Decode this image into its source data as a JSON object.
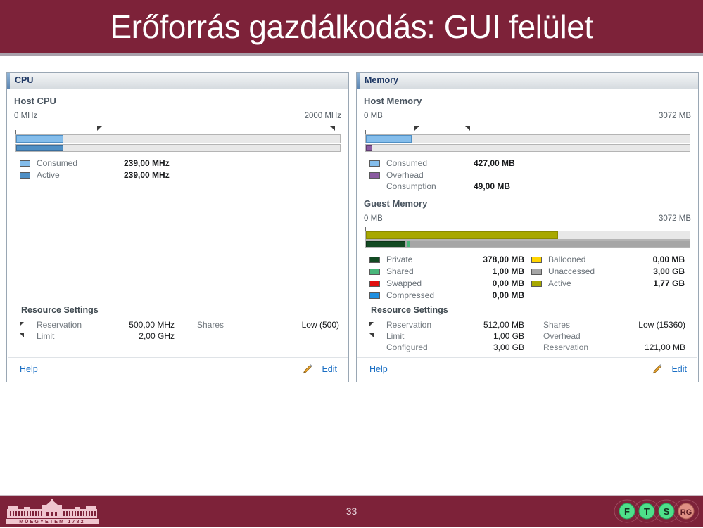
{
  "slide": {
    "title": "Erőforrás gazdálkodás: GUI felület",
    "page_number": "33",
    "title_bg": "#7d2239",
    "logo_text": "MŰEGYETEM 1782",
    "badges": [
      "F",
      "T",
      "S",
      "RG"
    ]
  },
  "cpu_panel": {
    "header": "CPU",
    "section_title": "Host CPU",
    "scale_min": "0 MHz",
    "scale_max": "2000 MHz",
    "legend": [
      {
        "label": "Consumed",
        "value": "239,00 MHz",
        "color": "#84bdeb"
      },
      {
        "label": "Active",
        "value": "239,00 MHz",
        "color": "#4f8fc4"
      }
    ],
    "resource_settings": {
      "title": "Resource Settings",
      "rows": [
        {
          "marker": "tl",
          "label": "Reservation",
          "value": "500,00 MHz",
          "label2": "Shares",
          "value2": "Low (500)"
        },
        {
          "marker": "tr",
          "label": "Limit",
          "value": "2,00 GHz",
          "label2": "",
          "value2": ""
        }
      ]
    },
    "help_label": "Help",
    "edit_label": "Edit"
  },
  "memory_panel": {
    "header": "Memory",
    "host": {
      "section_title": "Host Memory",
      "scale_min": "0 MB",
      "scale_max": "3072 MB",
      "legend": [
        {
          "label": "Consumed",
          "value": "427,00 MB",
          "color": "#84bdeb"
        },
        {
          "label": "Overhead",
          "value": "",
          "color": "#8a5aa0"
        },
        {
          "label": "Consumption",
          "value": "49,00 MB",
          "color": ""
        }
      ]
    },
    "guest": {
      "section_title": "Guest Memory",
      "scale_min": "0 MB",
      "scale_max": "3072 MB",
      "legend_left": [
        {
          "label": "Private",
          "value": "378,00 MB",
          "color": "#124a22"
        },
        {
          "label": "Shared",
          "value": "1,00 MB",
          "color": "#4ab77b"
        },
        {
          "label": "Swapped",
          "value": "0,00 MB",
          "color": "#e10f0f"
        },
        {
          "label": "Compressed",
          "value": "0,00 MB",
          "color": "#1f8fe0"
        }
      ],
      "legend_right": [
        {
          "label": "Ballooned",
          "value": "0,00 MB",
          "color": "#ffd400"
        },
        {
          "label": "Unaccessed",
          "value": "3,00 GB",
          "color": "#a6a6a6"
        },
        {
          "label": "Active",
          "value": "1,77 GB",
          "color": "#a8a800"
        }
      ]
    },
    "resource_settings": {
      "title": "Resource Settings",
      "rows": [
        {
          "marker": "tl",
          "label": "Reservation",
          "value": "512,00 MB",
          "label2": "Shares",
          "value2": "Low (15360)"
        },
        {
          "marker": "tr",
          "label": "Limit",
          "value": "1,00 GB",
          "label2": "Overhead",
          "value2": ""
        },
        {
          "marker": "",
          "label": "Configured",
          "value": "3,00 GB",
          "label2": "Reservation",
          "value2": "121,00 MB"
        }
      ]
    },
    "help_label": "Help",
    "edit_label": "Edit"
  },
  "chart_data": {
    "type": "bar",
    "title": "VM Resource Allocation (CPU and Memory)",
    "charts": [
      {
        "name": "Host CPU",
        "unit": "MHz",
        "axis_min": 0,
        "axis_max": 2000,
        "bars": [
          {
            "name": "Consumed",
            "value": 239,
            "color": "#84bdeb"
          },
          {
            "name": "Active",
            "value": 239,
            "color": "#4f8fc4"
          }
        ],
        "markers": [
          {
            "name": "Reservation",
            "value": 500
          },
          {
            "name": "Limit",
            "value": 2000
          }
        ]
      },
      {
        "name": "Host Memory",
        "unit": "MB",
        "axis_min": 0,
        "axis_max": 3072,
        "bars": [
          {
            "name": "Consumed",
            "value": 427,
            "color": "#84bdeb"
          },
          {
            "name": "Overhead Consumption",
            "value": 49,
            "color": "#8a5aa0"
          }
        ],
        "markers": [
          {
            "name": "Reservation",
            "value": 512
          },
          {
            "name": "Limit",
            "value": 1024
          }
        ]
      },
      {
        "name": "Guest Memory",
        "unit": "MB",
        "axis_min": 0,
        "axis_max": 3072,
        "bars": [
          {
            "name": "Active",
            "value": 1812,
            "color": "#a8a800"
          },
          {
            "name": "Private",
            "value": 378,
            "color": "#124a22"
          },
          {
            "name": "Shared",
            "value": 1,
            "color": "#4ab77b"
          },
          {
            "name": "Swapped",
            "value": 0,
            "color": "#e10f0f"
          },
          {
            "name": "Compressed",
            "value": 0,
            "color": "#1f8fe0"
          },
          {
            "name": "Ballooned",
            "value": 0,
            "color": "#ffd400"
          },
          {
            "name": "Unaccessed",
            "value": 3072,
            "color": "#a6a6a6"
          }
        ],
        "markers": []
      }
    ]
  }
}
